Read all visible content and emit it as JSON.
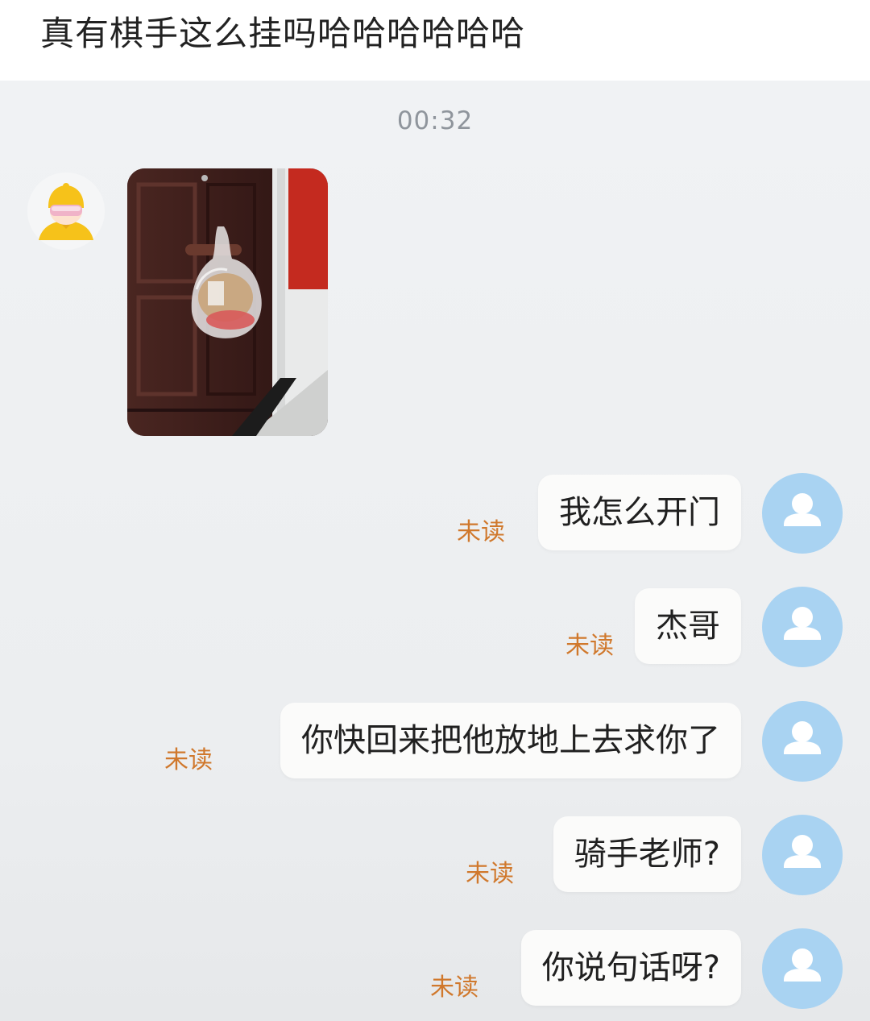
{
  "post": {
    "title": "真有棋手这么挂吗哈哈哈哈哈哈"
  },
  "chat": {
    "timestamp": "00:32",
    "incoming": {
      "sender": "rider",
      "avatar_icon": "rider-yellow-helmet-avatar",
      "photo_icon": "delivery-bag-on-door-handle-photo"
    },
    "outgoing": [
      {
        "text": "我怎么开门",
        "status": "未读"
      },
      {
        "text": "杰哥",
        "status": "未读"
      },
      {
        "text": "你快回来把他放地上去求你了",
        "status": "未读"
      },
      {
        "text": "骑手老师?",
        "status": "未读"
      },
      {
        "text": "你说句话呀?",
        "status": "未读"
      }
    ],
    "user_avatar_icon": "default-user-avatar"
  },
  "colors": {
    "background": "#eceef0",
    "bubble": "#fbfbfa",
    "unread": "#d0782c",
    "user_avatar": "#a9d3f2",
    "rider_helmet": "#f6c21a"
  }
}
